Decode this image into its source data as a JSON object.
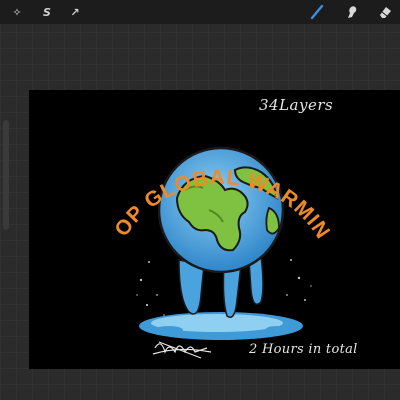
{
  "toolbar": {
    "left_tools": [
      {
        "name": "adjustments-icon",
        "glyph": "✧"
      },
      {
        "name": "selection-icon",
        "glyph": "S"
      },
      {
        "name": "transform-icon",
        "glyph": "↗"
      }
    ],
    "right_tools": [
      {
        "name": "brush-icon"
      },
      {
        "name": "smudge-icon"
      },
      {
        "name": "eraser-icon"
      }
    ],
    "active_tool": "brush",
    "accent_color": "#3d8fe0"
  },
  "artwork": {
    "arc_text": "STOP GLOBAL WARMING!",
    "arc_text_color": "#f08a24",
    "ocean_color": "#4aa3df",
    "land_color": "#7fc241",
    "note_layers": "34Layers",
    "note_time": "2 Hours in total"
  }
}
